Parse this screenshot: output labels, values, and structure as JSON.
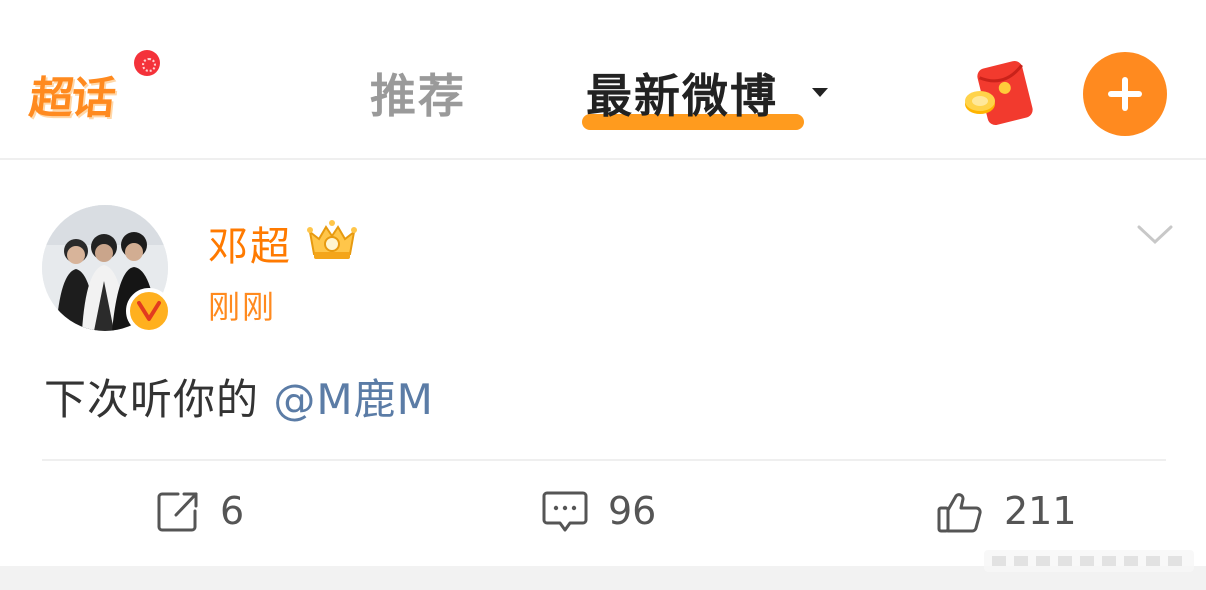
{
  "header": {
    "logo_text": "超话",
    "tabs": [
      {
        "label": "推荐",
        "active": false
      },
      {
        "label": "最新微博",
        "active": true
      }
    ],
    "accent_color": "#ff8a1f"
  },
  "post": {
    "author": "邓超",
    "time": "刚刚",
    "text_prefix": "下次听你的 ",
    "mention": "@M鹿M",
    "name_color": "#ff7a00",
    "mention_color": "#5b7ca6"
  },
  "actions": {
    "repost_count": "6",
    "comment_count": "96",
    "like_count": "211"
  },
  "icons": [
    "chaohua-logo",
    "caret-down-icon",
    "red-packet-icon",
    "plus-icon",
    "verified-icon",
    "vip-crown-icon",
    "chevron-down-icon",
    "repost-icon",
    "comment-icon",
    "like-icon"
  ]
}
